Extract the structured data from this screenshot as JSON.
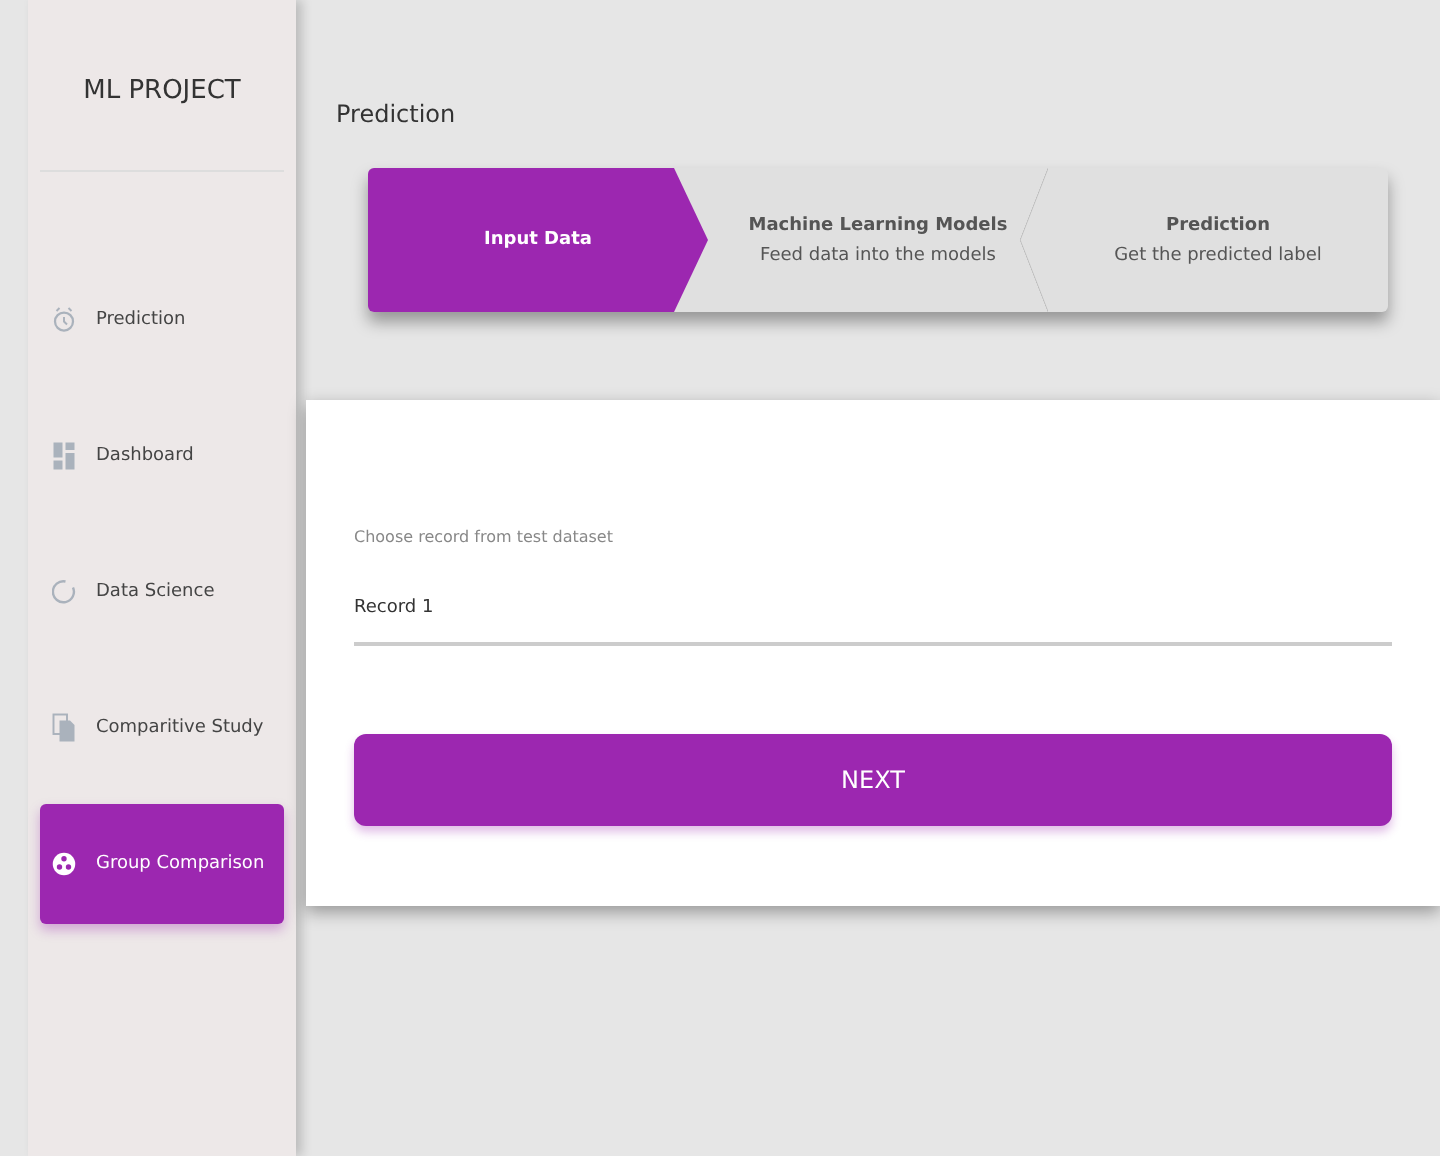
{
  "sidebar": {
    "title": "ML PROJECT",
    "items": [
      {
        "label": "Prediction",
        "kind": "clock",
        "selected": false
      },
      {
        "label": "Dashboard",
        "kind": "dashboard",
        "selected": false
      },
      {
        "label": "Data Science",
        "kind": "circle",
        "selected": false
      },
      {
        "label": "Comparitive Study",
        "kind": "document",
        "selected": false
      },
      {
        "label": "Group Comparison",
        "kind": "group",
        "selected": true
      }
    ]
  },
  "page_title": "Prediction",
  "steps": [
    {
      "title": "Input Data",
      "selected": true
    },
    {
      "title": "Machine Learning Models",
      "subtitle": "Feed data into the models",
      "selected": false
    },
    {
      "title": "Prediction",
      "subtitle": "Get the predicted label",
      "selected": false
    }
  ],
  "form": {
    "label": "Choose record from test dataset",
    "value": "Record 1",
    "button": "NEXT"
  }
}
